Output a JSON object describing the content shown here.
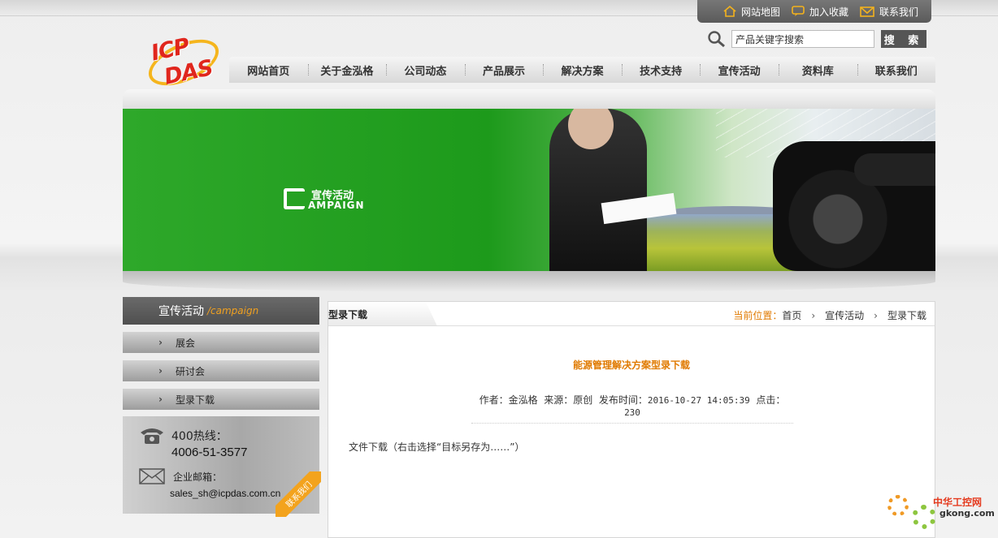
{
  "top_links": [
    {
      "label": "网站地图",
      "icon": "home-icon"
    },
    {
      "label": "加入收藏",
      "icon": "chat-bubble-icon"
    },
    {
      "label": "联系我们",
      "icon": "envelope-icon"
    }
  ],
  "logo": {
    "line1": "ICP",
    "line2": "DAS"
  },
  "search": {
    "placeholder": "产品关键字搜索",
    "button_label": "搜 索"
  },
  "nav": [
    "网站首页",
    "关于金泓格",
    "公司动态",
    "产品展示",
    "解决方案",
    "技术支持",
    "宣传活动",
    "资料库",
    "联系我们"
  ],
  "banner": {
    "title_zh": "宣传活动",
    "title_en": "AMPAIGN"
  },
  "sidebar": {
    "title": "宣传活动",
    "title_en": "/campaign",
    "items": [
      "展会",
      "研讨会",
      "型录下载"
    ],
    "hotline_label": "400热线：",
    "hotline_number": "4006-51-3577",
    "email_label": "企业邮箱：",
    "email": "sales_sh@icpdas.com.cn",
    "ribbon": "联系我们"
  },
  "content": {
    "tab": "型录下载",
    "breadcrumb_label": "当前位置：",
    "breadcrumb": [
      "首页",
      "宣传活动",
      "型录下载"
    ],
    "title": "能源管理解决方案型录下载",
    "meta": {
      "author_label": "作者：",
      "author": "金泓格",
      "source_label": "来源：",
      "source": "原创",
      "time_label": "发布时间：",
      "time": "2016-10-27 14:05:39",
      "clicks_label": "点击：",
      "clicks": "230"
    },
    "body": "文件下载（右击选择“目标另存为……”）"
  },
  "watermark": {
    "line1": "中华工控网",
    "line2": "gkong.com"
  },
  "colors": {
    "accent": "#e07a00",
    "brand_red": "#e0261d",
    "banner_green": "#1d9a1b"
  }
}
